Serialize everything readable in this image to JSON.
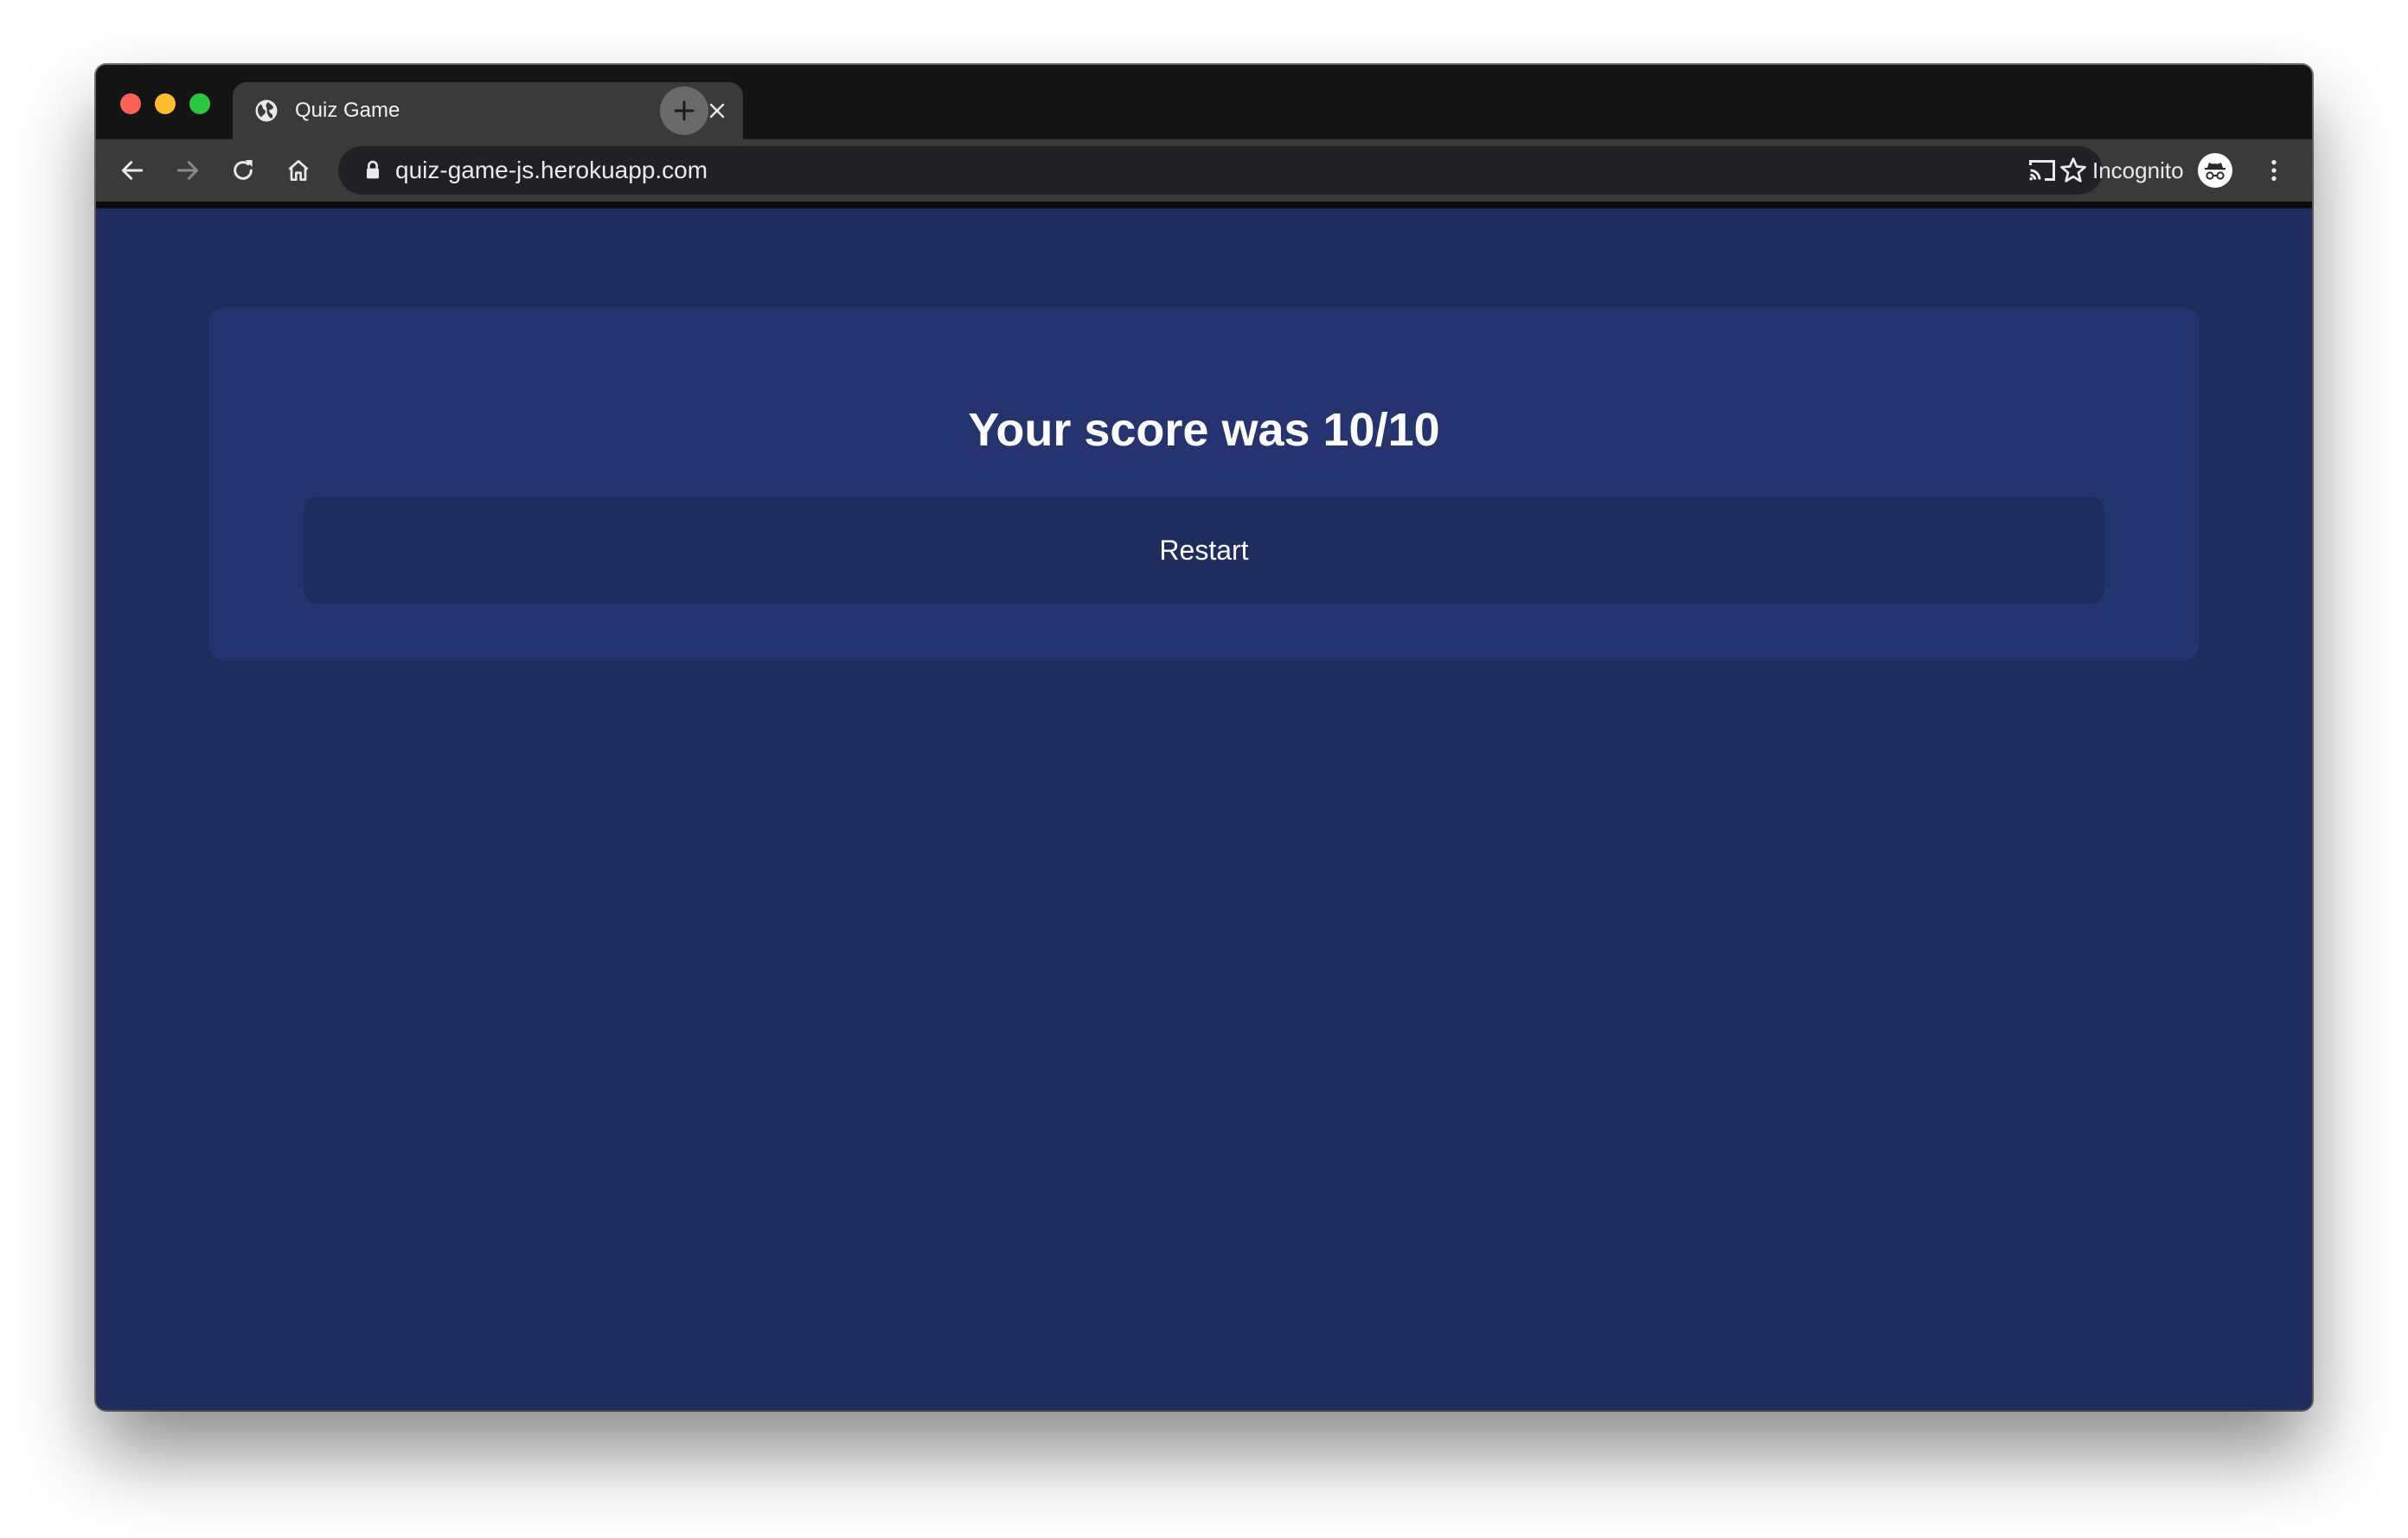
{
  "browser": {
    "tab": {
      "title": "Quiz Game",
      "favicon": "globe-icon"
    },
    "toolbar": {
      "url": "quiz-game-js.herokuapp.com",
      "mode_label": "Incognito",
      "icons": [
        "back-icon",
        "forward-icon",
        "reload-icon",
        "home-icon",
        "lock-icon",
        "star-icon",
        "cast-icon",
        "incognito-icon",
        "more-icon"
      ]
    }
  },
  "quiz": {
    "result_text": "Your score was 10/10",
    "restart_label": "Restart"
  },
  "colors": {
    "page_background": "#1f2d5e",
    "card_background": "#253470",
    "button_background": "#1f2d5e",
    "text": "#ffffff"
  }
}
